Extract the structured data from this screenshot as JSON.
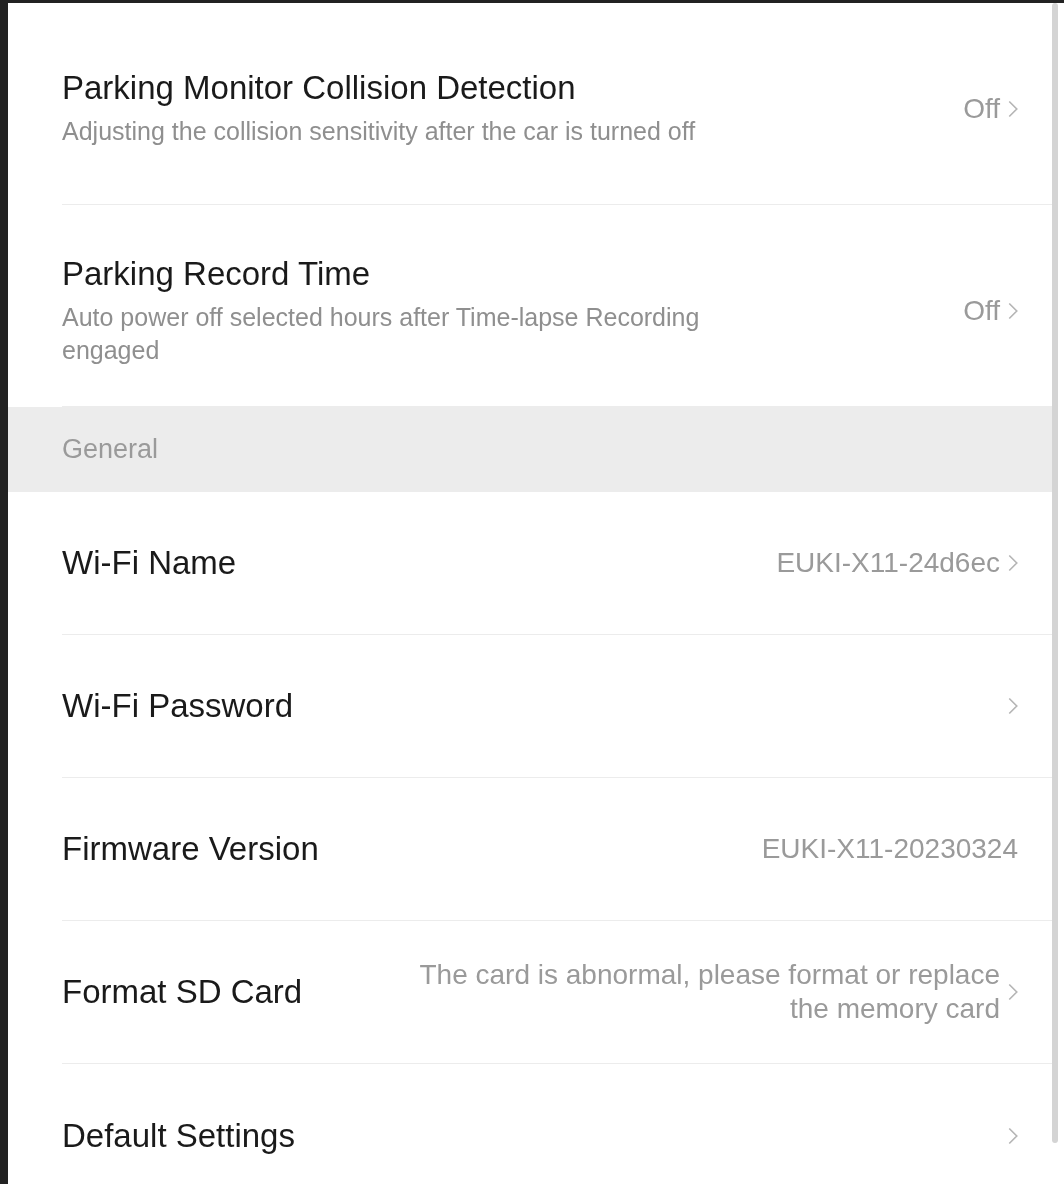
{
  "rows_top": [
    {
      "title": "Parking Monitor Collision Detection",
      "subtitle": "Adjusting the collision sensitivity after the car is turned off",
      "value": "Off",
      "chevron": true
    },
    {
      "title": "Parking Record Time",
      "subtitle": "Auto power off selected hours after Time-lapse Recording engaged",
      "value": "Off",
      "chevron": true
    }
  ],
  "section": {
    "title": "General"
  },
  "rows": [
    {
      "title": "Wi-Fi Name",
      "value": "EUKI-X11-24d6ec",
      "chevron": true
    },
    {
      "title": "Wi-Fi Password",
      "chevron": true
    },
    {
      "title": "Firmware Version",
      "value": "EUKI-X11-20230324",
      "chevron": false
    },
    {
      "title": "Format SD Card",
      "value": "The card is abnormal, please format or replace the memory card",
      "chevron": true
    },
    {
      "title": "Default Settings",
      "chevron": true
    }
  ]
}
